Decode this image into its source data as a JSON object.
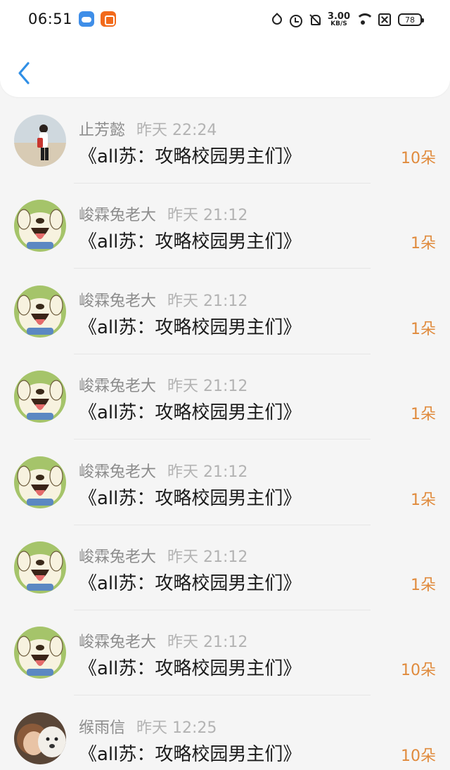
{
  "status_bar": {
    "time": "06:51",
    "app_icons": [
      "weather-app-icon",
      "video-app-icon"
    ],
    "net_speed_value": "3.00",
    "net_speed_unit": "KB/S",
    "battery": "78"
  },
  "nav": {
    "back_icon": "chevron-left-icon"
  },
  "colors": {
    "accent": "#2f8fe6",
    "count": "#e08a3c",
    "name": "#8c8c8c",
    "time": "#b3b3b3"
  },
  "items": [
    {
      "name": "止芳懿",
      "time": "昨天 22:24",
      "title": "《all苏：攻略校园男主们》",
      "count": "10朵",
      "avatar": "photo-girl"
    },
    {
      "name": "峻霖兔老大",
      "time": "昨天 21:12",
      "title": "《all苏：攻略校园男主们》",
      "count": "1朵",
      "avatar": "cartoon-dog"
    },
    {
      "name": "峻霖兔老大",
      "time": "昨天 21:12",
      "title": "《all苏：攻略校园男主们》",
      "count": "1朵",
      "avatar": "cartoon-dog"
    },
    {
      "name": "峻霖兔老大",
      "time": "昨天 21:12",
      "title": "《all苏：攻略校园男主们》",
      "count": "1朵",
      "avatar": "cartoon-dog"
    },
    {
      "name": "峻霖兔老大",
      "time": "昨天 21:12",
      "title": "《all苏：攻略校园男主们》",
      "count": "1朵",
      "avatar": "cartoon-dog"
    },
    {
      "name": "峻霖兔老大",
      "time": "昨天 21:12",
      "title": "《all苏：攻略校园男主们》",
      "count": "1朵",
      "avatar": "cartoon-dog"
    },
    {
      "name": "峻霖兔老大",
      "time": "昨天 21:12",
      "title": "《all苏：攻略校园男主们》",
      "count": "10朵",
      "avatar": "cartoon-dog"
    },
    {
      "name": "缑雨信",
      "time": "昨天 12:25",
      "title": "《all苏：攻略校园男主们》",
      "count": "10朵",
      "avatar": "photo-child-dog"
    }
  ]
}
